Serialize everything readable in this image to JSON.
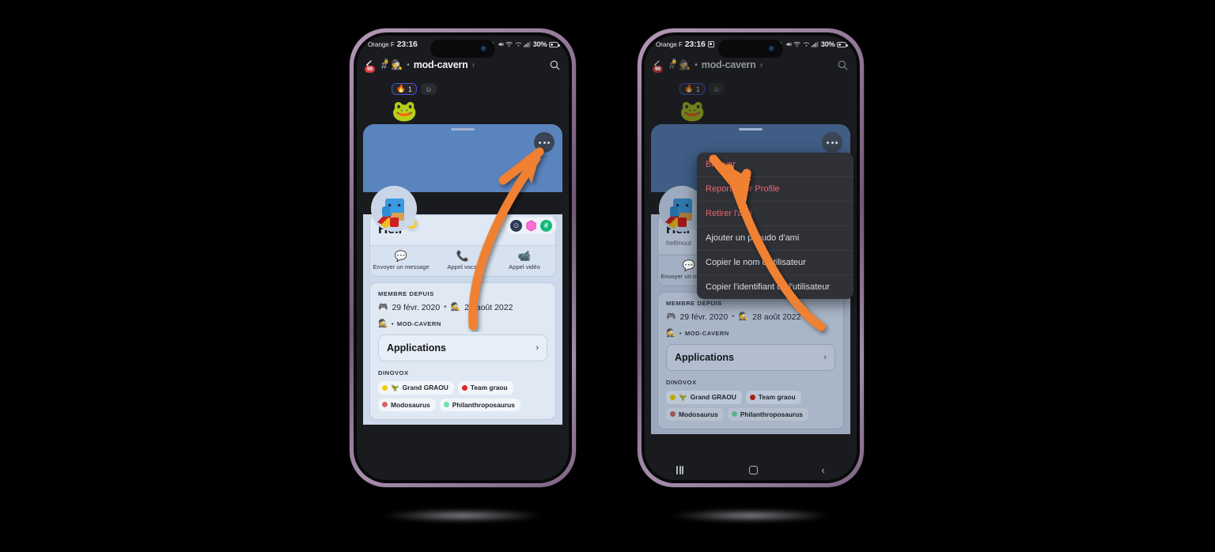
{
  "meta": {
    "accent_orange": "#f08030",
    "banner_blue": "#5a84bd",
    "card_bg": "#ccd9ea",
    "menu_bg": "#2f3136",
    "danger_red": "#e8666f",
    "frame_purple": "#8d7391"
  },
  "status_bar": {
    "carrier": "Orange F",
    "time": "23:16",
    "battery_percent": "30%",
    "icons": [
      "alarm-icon",
      "bluetooth-icon",
      "mute-icon",
      "wifi-icon",
      "signal-icon",
      "battery-icon"
    ],
    "screenshot_icon_visible_right": true
  },
  "header": {
    "back_badge": "99",
    "hash_icon": "hash-lock-icon",
    "server_emoji": "🕵️",
    "separator": "•",
    "title": "mod-cavern",
    "chevron": "›",
    "search_icon": "search-icon"
  },
  "chat": {
    "reaction_emoji": "🔥",
    "reaction_count": "1",
    "add_reaction_icon": "add-reaction-icon",
    "sticker_emoji": "🐸"
  },
  "profile": {
    "more_button": "more-options-button",
    "avatar_status": "🌙",
    "badges": [
      {
        "name": "badge-nitro",
        "glyph": "⊙",
        "style": "dark"
      },
      {
        "name": "badge-hexagon",
        "glyph": "⬡",
        "style": "hex"
      },
      {
        "name": "badge-hash",
        "glyph": "#",
        "style": "green"
      }
    ],
    "display_name": "Hell",
    "username": "hellmout",
    "actions": [
      {
        "icon": "message-icon",
        "glyph": "💬",
        "label": "Envoyer un message"
      },
      {
        "icon": "phone-icon",
        "glyph": "📞",
        "label": "Appel vocal"
      },
      {
        "icon": "video-icon",
        "glyph": "📹",
        "label": "Appel vidéo"
      }
    ],
    "member_since_label": "MEMBRE DEPUIS",
    "discord_join_date": "29 févr. 2020",
    "date_separator": "•",
    "server_join_date": "28 août 2022",
    "server_emoji": "🕵️",
    "server_dot": "•",
    "server_name": "MOD-CAVERN",
    "applications_label": "Applications",
    "applications_chevron": "›",
    "roles_title": "DINOVOX",
    "roles": [
      {
        "label": "Grand GRAOU",
        "color": "#f0d000",
        "emoji": "🦖"
      },
      {
        "label": "Team graou",
        "color": "#e02424",
        "emoji": ""
      },
      {
        "label": "Modosaurus",
        "color": "#d06a6a",
        "emoji": ""
      },
      {
        "label": "Philanthroposaurus",
        "color": "#6ee0a8",
        "emoji": ""
      }
    ]
  },
  "context_menu": {
    "items": [
      {
        "label": "Bloquer",
        "danger": true
      },
      {
        "label": "Report User Profile",
        "danger": true
      },
      {
        "label": "Retirer l'ami",
        "danger": true
      },
      {
        "label": "Ajouter un pseudo d'ami",
        "danger": false
      },
      {
        "label": "Copier le nom d'utilisateur",
        "danger": false
      },
      {
        "label": "Copier l'identifiant de l'utilisateur",
        "danger": false
      }
    ]
  },
  "nav_bar": {
    "recents_icon": "recents-icon",
    "home_icon": "home-icon",
    "back_icon": "back-icon",
    "back_glyph": "‹"
  }
}
